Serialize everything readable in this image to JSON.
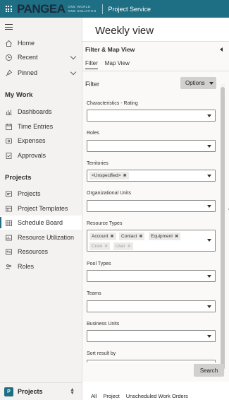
{
  "topbar": {
    "brand_name": "PANGEA",
    "brand_tagline_1": "ONE WORLD",
    "brand_tagline_2": "ONE SOLUTION",
    "app_title": "Project Service",
    "bar_color": "#1f6f84"
  },
  "sidebar": {
    "top_items": [
      {
        "label": "Home",
        "icon": "home-icon"
      },
      {
        "label": "Recent",
        "icon": "clock-icon"
      },
      {
        "label": "Pinned",
        "icon": "pin-icon"
      }
    ],
    "my_work_title": "My Work",
    "my_work_items": [
      {
        "label": "Dashboards",
        "icon": "dashboard-icon"
      },
      {
        "label": "Time Entries",
        "icon": "calendar-icon"
      },
      {
        "label": "Expenses",
        "icon": "expense-icon"
      },
      {
        "label": "Approvals",
        "icon": "approval-icon"
      }
    ],
    "projects_title": "Projects",
    "projects_items": [
      {
        "label": "Projects",
        "icon": "projects-icon"
      },
      {
        "label": "Project Templates",
        "icon": "template-icon"
      },
      {
        "label": "Schedule Board",
        "icon": "schedule-icon"
      },
      {
        "label": "Resource Utilization",
        "icon": "utilization-icon"
      },
      {
        "label": "Resources",
        "icon": "resources-icon"
      },
      {
        "label": "Roles",
        "icon": "roles-icon"
      }
    ],
    "area_badge": "P",
    "area_label": "Projects"
  },
  "main": {
    "page_title": "Weekly view",
    "panel_title": "Filter & Map View",
    "tabs": [
      "Filter",
      "Map View"
    ],
    "filter_label": "Filter",
    "options_label": "Options",
    "fields": {
      "characteristics": "Characteristics - Rating",
      "roles": "Roles",
      "territories": "Territories",
      "territory_chip": "<Unspecified>",
      "org_units": "Organizational Units",
      "resource_types": "Resource Types",
      "resource_type_chips": [
        "Account",
        "Contact",
        "Equipment"
      ],
      "resource_type_chips_dim": [
        "Crew",
        "User"
      ],
      "pool_types": "Pool Types",
      "teams": "Teams",
      "business_units": "Business Units",
      "sort_result": "Sort result by"
    },
    "search_label": "Search",
    "bottom_tabs": [
      "All",
      "Project",
      "Unscheduled Work Orders"
    ]
  }
}
